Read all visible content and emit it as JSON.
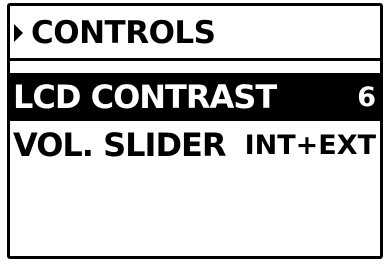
{
  "screen": {
    "title": "CONTROLS",
    "title_icon": "right-triangle-icon"
  },
  "menu": {
    "selected_index": 0,
    "items": [
      {
        "label": "LCD CONTRAST",
        "value": "6"
      },
      {
        "label": "VOL. SLIDER",
        "value": "INT+EXT"
      }
    ]
  },
  "colors": {
    "foreground": "#000000",
    "background": "#ffffff"
  }
}
